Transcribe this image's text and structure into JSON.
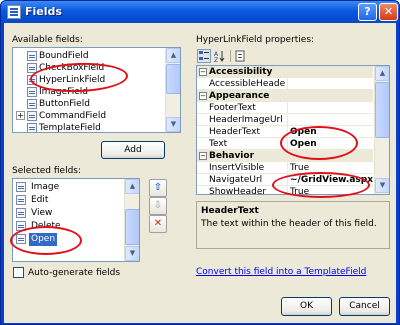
{
  "window": {
    "title": "Fields",
    "help_glyph": "?",
    "close_glyph": "✕"
  },
  "available": {
    "label": "Available fields:",
    "items": [
      {
        "label": "BoundField",
        "expandable": false
      },
      {
        "label": "CheckBoxField",
        "expandable": false
      },
      {
        "label": "HyperLinkField",
        "expandable": false
      },
      {
        "label": "ImageField",
        "expandable": false
      },
      {
        "label": "ButtonField",
        "expandable": false
      },
      {
        "label": "CommandField",
        "expandable": true
      },
      {
        "label": "TemplateField",
        "expandable": false
      }
    ],
    "add_label": "Add"
  },
  "selected": {
    "label": "Selected fields:",
    "items": [
      "Image",
      "Edit",
      "View",
      "Delete",
      "Open"
    ],
    "selected_item": "Open",
    "move_up": "⇧",
    "move_down": "⇩",
    "delete": "✕"
  },
  "autogenerate": {
    "label": "Auto-generate fields",
    "checked": false
  },
  "properties": {
    "label": "HyperLinkField properties:",
    "categories": [
      {
        "name": "Accessibility",
        "rows": [
          {
            "name": "AccessibleHeaderTe",
            "value": ""
          }
        ]
      },
      {
        "name": "Appearance",
        "rows": [
          {
            "name": "FooterText",
            "value": ""
          },
          {
            "name": "HeaderImageUrl",
            "value": ""
          },
          {
            "name": "HeaderText",
            "value": "Open"
          },
          {
            "name": "Text",
            "value": "Open"
          }
        ]
      },
      {
        "name": "Behavior",
        "rows": [
          {
            "name": "InsertVisible",
            "value": "True"
          },
          {
            "name": "NavigateUrl",
            "value": "~/GridView.aspx"
          },
          {
            "name": "ShowHeader",
            "value": "True"
          }
        ]
      }
    ],
    "description_title": "HeaderText",
    "description_text": "The text within the header of this field."
  },
  "convert_link": "Convert this field into a TemplateField",
  "ok_label": "OK",
  "cancel_label": "Cancel",
  "colors": {
    "highlight": "#e0101a",
    "selection": "#316ac5",
    "link": "#0000ff"
  }
}
